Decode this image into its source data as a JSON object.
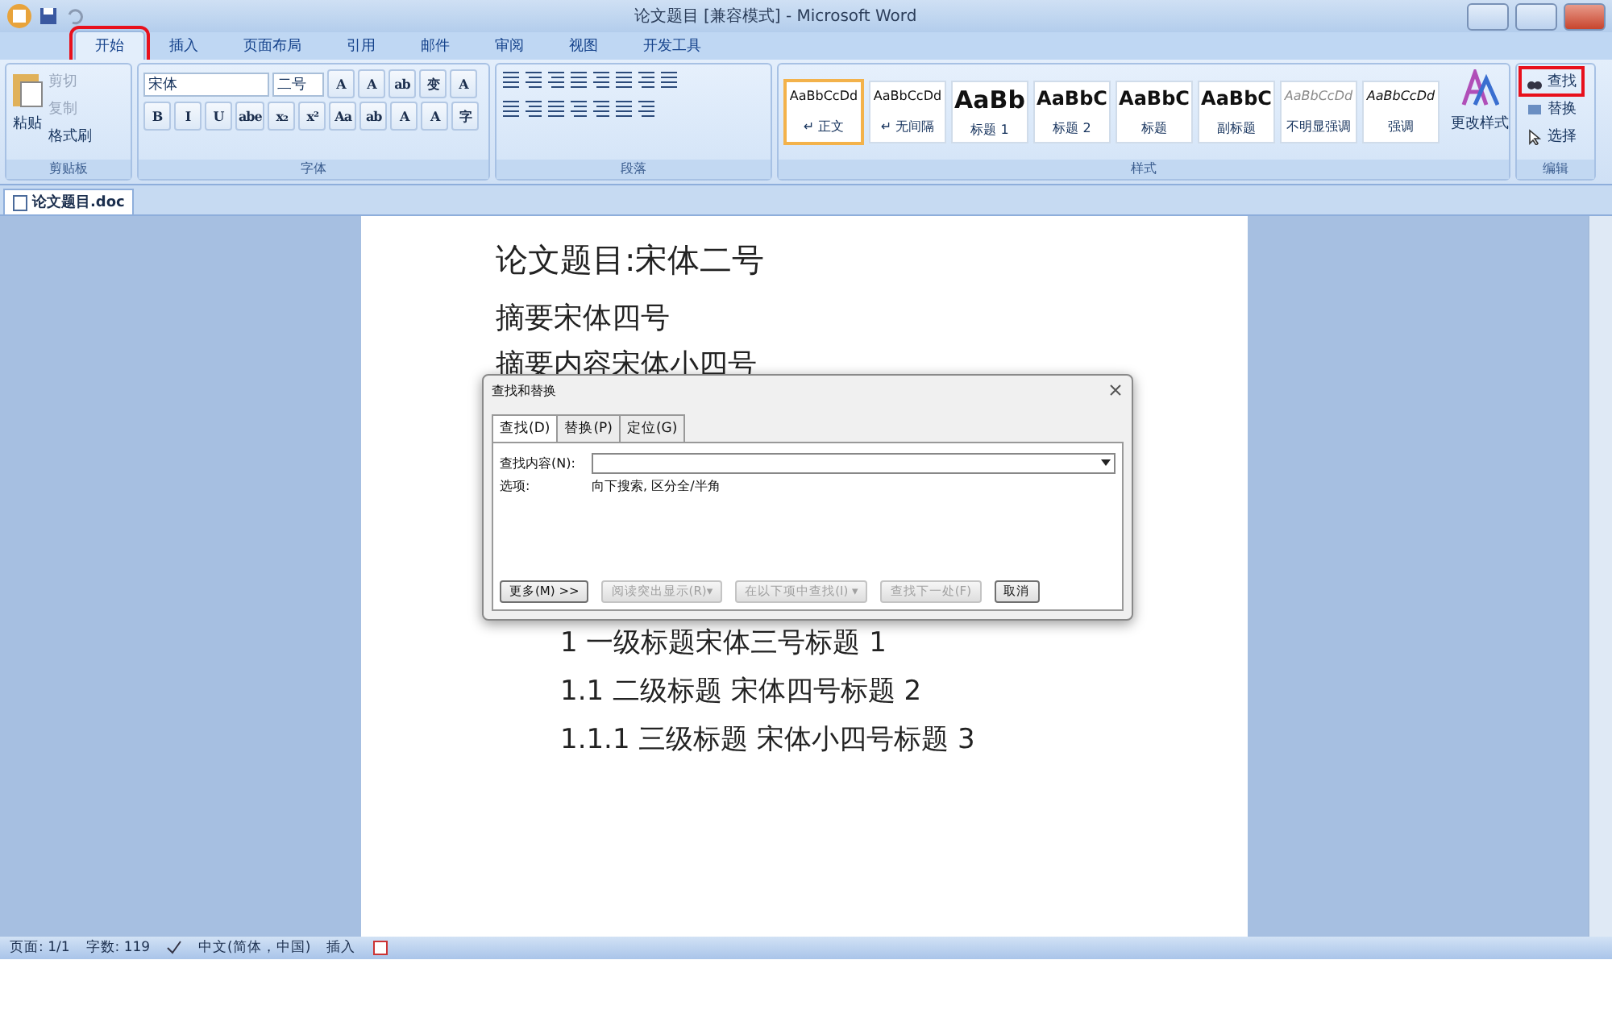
{
  "window": {
    "title": "论文题目 [兼容模式] - Microsoft Word"
  },
  "ribbon_tabs": [
    {
      "label": "开始",
      "selected": true,
      "highlighted": true
    },
    {
      "label": "插入",
      "selected": false,
      "highlighted": false
    },
    {
      "label": "页面布局",
      "selected": false,
      "highlighted": false
    },
    {
      "label": "引用",
      "selected": false,
      "highlighted": false
    },
    {
      "label": "邮件",
      "selected": false,
      "highlighted": false
    },
    {
      "label": "审阅",
      "selected": false,
      "highlighted": false
    },
    {
      "label": "视图",
      "selected": false,
      "highlighted": false
    },
    {
      "label": "开发工具",
      "selected": false,
      "highlighted": false
    }
  ],
  "clipboard": {
    "name": "剪贴板",
    "paste": "粘贴",
    "items": [
      {
        "label": "剪切",
        "disabled": true
      },
      {
        "label": "复制",
        "disabled": true
      },
      {
        "label": "格式刷",
        "disabled": false
      }
    ]
  },
  "font": {
    "name": "字体",
    "font_name": "宋体",
    "font_size": "二号",
    "row1": [
      "A",
      "A",
      "ab",
      "变",
      "A"
    ],
    "row2": [
      "B",
      "I",
      "U",
      "abe",
      "x₂",
      "x²",
      "Aa",
      "ab",
      "A",
      "A",
      "字"
    ]
  },
  "paragraph": {
    "name": "段落"
  },
  "styles": {
    "name": "样式",
    "items": [
      {
        "preview": "AaBbCcDd",
        "label": "↵ 正文",
        "kind": "normal",
        "selected": true
      },
      {
        "preview": "AaBbCcDd",
        "label": "↵ 无间隔",
        "kind": "normal",
        "selected": false
      },
      {
        "preview": "AaBb",
        "label": "标题 1",
        "kind": "heading1",
        "selected": false
      },
      {
        "preview": "AaBbC",
        "label": "标题 2",
        "kind": "heading2",
        "selected": false
      },
      {
        "preview": "AaBbC",
        "label": "标题",
        "kind": "heading2",
        "selected": false
      },
      {
        "preview": "AaBbC",
        "label": "副标题",
        "kind": "heading2",
        "selected": false
      },
      {
        "preview": "AaBbCcDd",
        "label": "不明显强调",
        "kind": "subtle",
        "selected": false
      },
      {
        "preview": "AaBbCcDd",
        "label": "强调",
        "kind": "emphasis",
        "selected": false
      }
    ],
    "change_styles": "更改样式"
  },
  "editing": {
    "name": "编辑",
    "items": [
      {
        "label": "查找",
        "kind": "find",
        "highlighted": true
      },
      {
        "label": "替换",
        "kind": "replace",
        "highlighted": false
      },
      {
        "label": "选择",
        "kind": "select",
        "highlighted": false
      }
    ]
  },
  "document_tab": "论文题目.doc",
  "document": {
    "lines_top": [
      {
        "text": "论文题目:宋体二号",
        "kind": "title"
      },
      {
        "text": "摘要宋体四号",
        "kind": "body"
      },
      {
        "text": "摘要内容宋体小四号",
        "kind": "body"
      }
    ],
    "lines_bottom": [
      "1 一级标题宋体三号标题 1",
      "1.1 二级标题  宋体四号标题 2",
      "1.1.1  三级标题  宋体小四号标题 3"
    ]
  },
  "dialog": {
    "title": "查找和替换",
    "tabs": [
      {
        "label": "查找(D)",
        "selected": true
      },
      {
        "label": "替换(P)",
        "selected": false
      },
      {
        "label": "定位(G)",
        "selected": false
      }
    ],
    "find_label": "查找内容(N):",
    "options_label": "选项:",
    "options_value": "向下搜索, 区分全/半角",
    "buttons": [
      {
        "label": "更多(M) >>",
        "disabled": false
      },
      {
        "label": "阅读突出显示(R)▾",
        "disabled": true
      },
      {
        "label": "在以下项中查找(I) ▾",
        "disabled": true
      },
      {
        "label": "查找下一处(F)",
        "disabled": true
      },
      {
        "label": "取消",
        "disabled": false
      }
    ]
  },
  "status_bar": [
    {
      "text": "页面: 1/1",
      "kind": "text"
    },
    {
      "text": "字数: 119",
      "kind": "text"
    },
    {
      "kind": "proof"
    },
    {
      "text": "中文(简体，中国)",
      "kind": "text"
    },
    {
      "text": "插入",
      "kind": "text"
    },
    {
      "kind": "macro"
    }
  ]
}
